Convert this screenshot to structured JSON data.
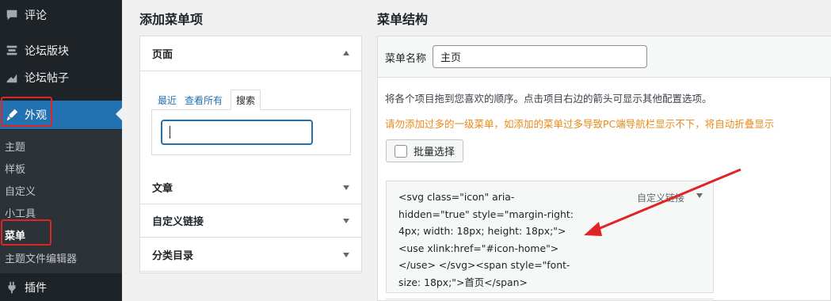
{
  "sidebar": {
    "items": [
      {
        "label": "评论",
        "icon": "comments-icon"
      },
      {
        "label": "论坛版块",
        "icon": "forum-icon"
      },
      {
        "label": "论坛帖子",
        "icon": "topics-icon"
      },
      {
        "label": "外观",
        "icon": "appearance-icon",
        "active": true
      },
      {
        "label": "插件",
        "icon": "plugins-icon"
      }
    ],
    "submenu": [
      "主题",
      "样板",
      "自定义",
      "小工具",
      "菜单",
      "主题文件编辑器"
    ],
    "current_submenu": "菜单"
  },
  "add_items": {
    "title": "添加菜单项",
    "sections": [
      "页面",
      "文章",
      "自定义链接",
      "分类目录"
    ],
    "tabs": [
      "最近",
      "查看所有",
      "搜索"
    ],
    "active_tab": "搜索",
    "search_value": ""
  },
  "menu_structure": {
    "title": "菜单结构",
    "name_label": "菜单名称",
    "name_value": "主页",
    "instruction": "将各个项目拖到您喜欢的顺序。点击项目右边的箭头可显示其他配置选项。",
    "warning": "请勿添加过多的一级菜单，如添加的菜单过多导致PC端导航栏显示不下，将自动折叠显示",
    "bulk_select_label": "批量选择",
    "item_code": "<svg class=\"icon\" aria-\nhidden=\"true\" style=\"margin-right:\n4px; width: 18px; height: 18px;\">\n<use xlink:href=\"#icon-home\">\n</use> </svg><span style=\"font-\nsize: 18px;\">首页</span>",
    "item_type": "自定义链接"
  },
  "colors": {
    "sidebar_bg": "#1d2327",
    "accent": "#2271b1",
    "warning": "#e88a1a",
    "highlight_red": "#e02424"
  }
}
